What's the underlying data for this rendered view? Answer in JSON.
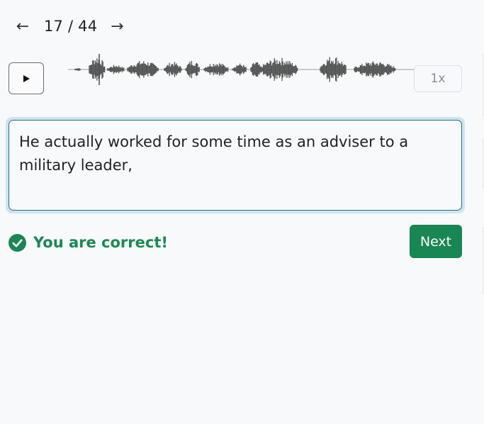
{
  "navigation": {
    "prev_icon": "arrow-left-icon",
    "counter": "17 / 44",
    "next_icon": "arrow-right-icon"
  },
  "player": {
    "play_icon": "play-icon",
    "speed_label": "1x"
  },
  "answer": {
    "text": "He actually worked for some time as an adviser to a military leader,"
  },
  "result": {
    "icon": "check-circle-icon",
    "message": "You are correct!"
  },
  "actions": {
    "next_label": "Next"
  },
  "colors": {
    "success": "#198754",
    "waveform": "#555555",
    "focus_ring": "#cfe2f7"
  }
}
